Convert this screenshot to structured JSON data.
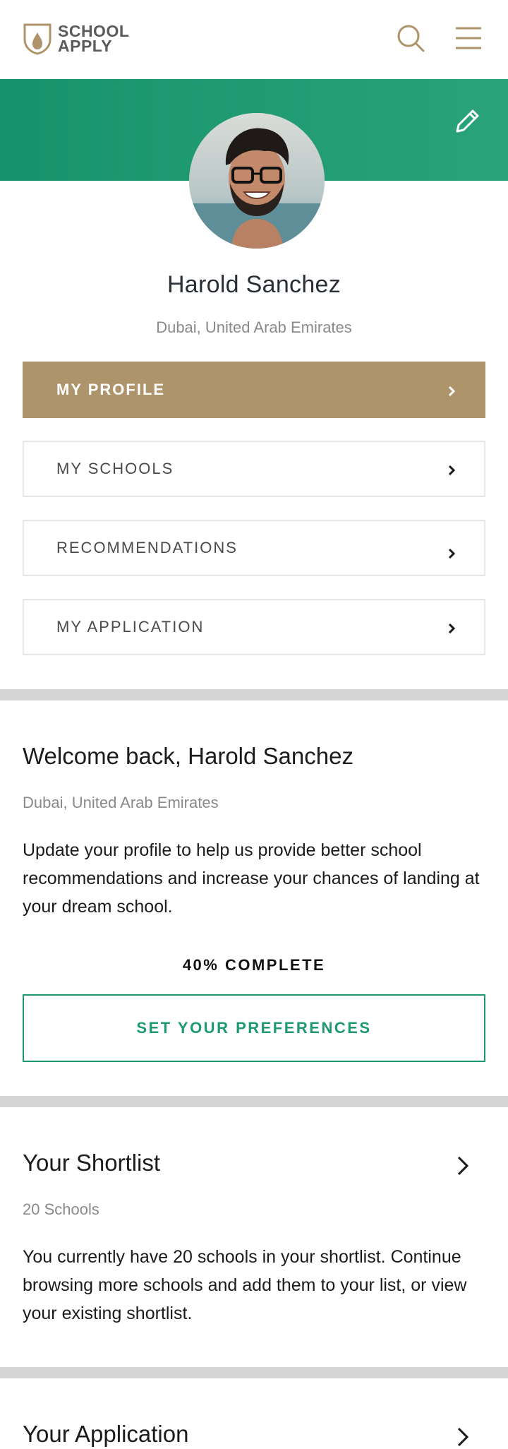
{
  "brand": {
    "line1": "SCHOOL",
    "line2": "APPLY",
    "accent": "#ad946b",
    "green": "#1f9a6f"
  },
  "header": {
    "search_icon": "search-icon",
    "menu_icon": "hamburger-menu-icon"
  },
  "profile": {
    "name": "Harold Sanchez",
    "location": "Dubai, United Arab Emirates",
    "edit_icon": "pencil-icon"
  },
  "nav": {
    "items": [
      {
        "label": "MY PROFILE",
        "active": true
      },
      {
        "label": "MY SCHOOLS",
        "active": false
      },
      {
        "label": "RECOMMENDATIONS",
        "active": false
      },
      {
        "label": "MY APPLICATION",
        "active": false
      }
    ]
  },
  "welcome": {
    "title": "Welcome back, Harold Sanchez",
    "location": "Dubai, United Arab Emirates",
    "body": "Update your profile to help us provide better school recommendations and increase your chances of landing at your dream school.",
    "progress_label": "40% COMPLETE",
    "progress_value": 0.4,
    "button": "SET YOUR PREFERENCES"
  },
  "shortlist": {
    "title": "Your Shortlist",
    "count": "20 Schools",
    "body": "You currently have 20 schools in your shortlist. Continue browsing more schools and add them to your list, or view your existing shortlist."
  },
  "application": {
    "title": "Your Application"
  }
}
